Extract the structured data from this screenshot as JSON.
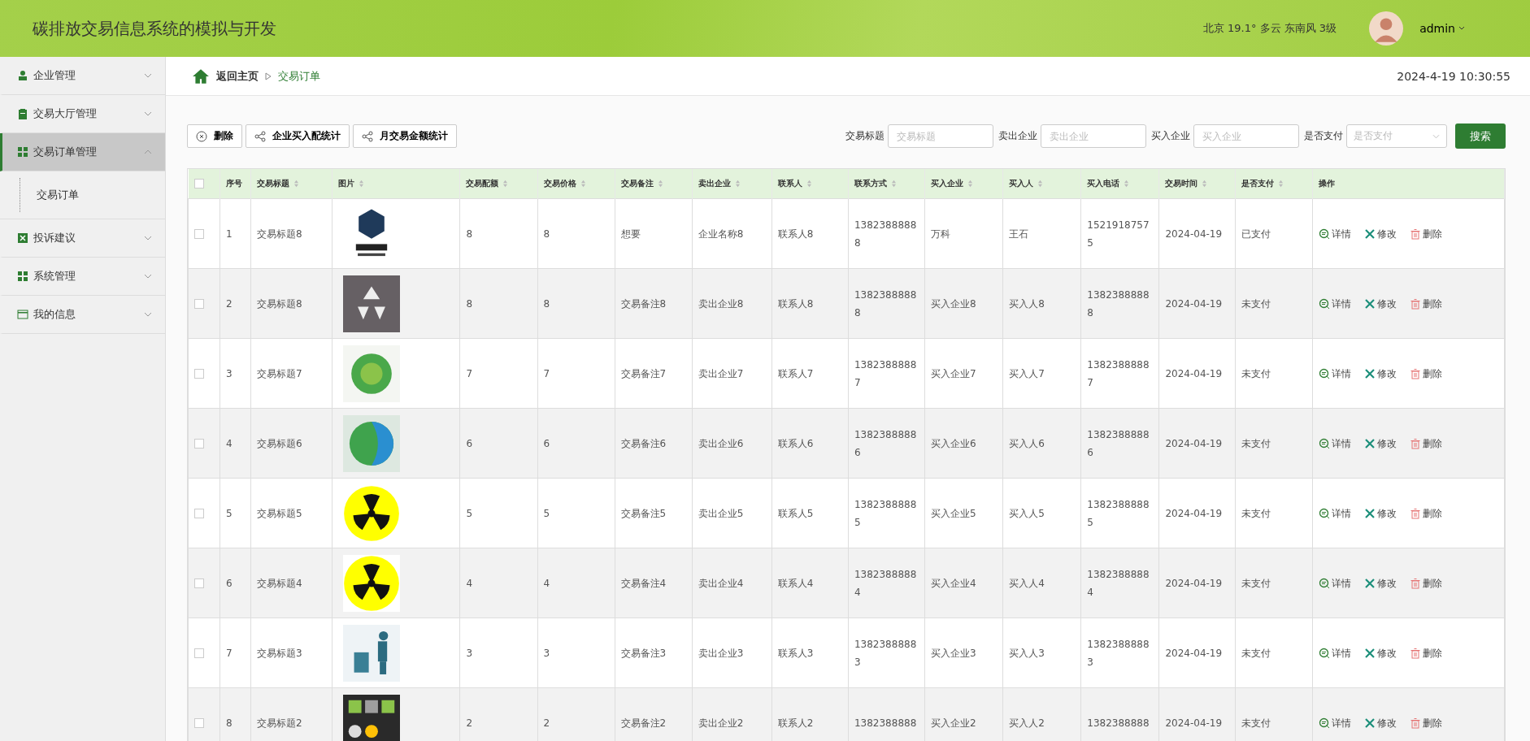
{
  "header": {
    "title": "碳排放交易信息系统的模拟与开发",
    "weather": "北京  19.1°  多云  东南风  3级",
    "user": "admin"
  },
  "sidebar": {
    "items": [
      {
        "label": "企业管理",
        "kind": "person",
        "expanded": false,
        "selected": false
      },
      {
        "label": "交易大厅管理",
        "kind": "clipboard",
        "expanded": false,
        "selected": false
      },
      {
        "label": "交易订单管理",
        "kind": "grid",
        "expanded": true,
        "selected": true,
        "children": [
          {
            "label": "交易订单"
          }
        ]
      },
      {
        "label": "投诉建议",
        "kind": "xbox",
        "expanded": false,
        "selected": false
      },
      {
        "label": "系统管理",
        "kind": "grid",
        "expanded": false,
        "selected": false
      },
      {
        "label": "我的信息",
        "kind": "card",
        "expanded": false,
        "selected": false
      }
    ]
  },
  "breadcrumb": {
    "home": "返回主页",
    "current": "交易订单",
    "datetime": "2024-4-19 10:30:55"
  },
  "toolbar": {
    "buttons": [
      {
        "label": "删除",
        "kind": "delete"
      },
      {
        "label": "企业买入配统计",
        "kind": "share"
      },
      {
        "label": "月交易金额统计",
        "kind": "share"
      }
    ]
  },
  "search": {
    "fields": [
      {
        "label": "交易标题",
        "placeholder": "交易标题",
        "kind": "text"
      },
      {
        "label": "卖出企业",
        "placeholder": "卖出企业",
        "kind": "text"
      },
      {
        "label": "买入企业",
        "placeholder": "买入企业",
        "kind": "text"
      },
      {
        "label": "是否支付",
        "placeholder": "是否支付",
        "kind": "select"
      }
    ],
    "button": "搜索"
  },
  "table": {
    "header_checked": false,
    "columns": [
      {
        "label": "序号",
        "sortable": false
      },
      {
        "label": "交易标题",
        "sortable": true
      },
      {
        "label": "图片",
        "sortable": true
      },
      {
        "label": "交易配额",
        "sortable": true
      },
      {
        "label": "交易价格",
        "sortable": true
      },
      {
        "label": "交易备注",
        "sortable": true
      },
      {
        "label": "卖出企业",
        "sortable": true
      },
      {
        "label": "联系人",
        "sortable": true
      },
      {
        "label": "联系方式",
        "sortable": true
      },
      {
        "label": "买入企业",
        "sortable": true
      },
      {
        "label": "买入人",
        "sortable": true
      },
      {
        "label": "买入电话",
        "sortable": true
      },
      {
        "label": "交易时间",
        "sortable": true
      },
      {
        "label": "是否支付",
        "sortable": true
      },
      {
        "label": "操作",
        "sortable": false
      }
    ],
    "rows": [
      {
        "checked": false,
        "actions": [
          "详情",
          "修改",
          "删除"
        ],
        "cells": [
          "1",
          "交易标题8",
          null,
          "8",
          "8",
          "想要",
          "企业名称8",
          "联系人8",
          "13823888888",
          "万科",
          "王石",
          "15219187575",
          "2024-04-19",
          "已支付"
        ]
      },
      {
        "checked": false,
        "actions": [
          "详情",
          "修改",
          "删除"
        ],
        "cells": [
          "2",
          "交易标题8",
          null,
          "8",
          "8",
          "交易备注8",
          "卖出企业8",
          "联系人8",
          "13823888888",
          "买入企业8",
          "买入人8",
          "13823888888",
          "2024-04-19",
          "未支付"
        ]
      },
      {
        "checked": false,
        "actions": [
          "详情",
          "修改",
          "删除"
        ],
        "cells": [
          "3",
          "交易标题7",
          null,
          "7",
          "7",
          "交易备注7",
          "卖出企业7",
          "联系人7",
          "13823888887",
          "买入企业7",
          "买入人7",
          "13823888887",
          "2024-04-19",
          "未支付"
        ]
      },
      {
        "checked": false,
        "actions": [
          "详情",
          "修改",
          "删除"
        ],
        "cells": [
          "4",
          "交易标题6",
          null,
          "6",
          "6",
          "交易备注6",
          "卖出企业6",
          "联系人6",
          "13823888886",
          "买入企业6",
          "买入人6",
          "13823888886",
          "2024-04-19",
          "未支付"
        ]
      },
      {
        "checked": false,
        "actions": [
          "详情",
          "修改",
          "删除"
        ],
        "cells": [
          "5",
          "交易标题5",
          null,
          "5",
          "5",
          "交易备注5",
          "卖出企业5",
          "联系人5",
          "13823888885",
          "买入企业5",
          "买入人5",
          "13823888885",
          "2024-04-19",
          "未支付"
        ]
      },
      {
        "checked": false,
        "actions": [
          "详情",
          "修改",
          "删除"
        ],
        "cells": [
          "6",
          "交易标题4",
          null,
          "4",
          "4",
          "交易备注4",
          "卖出企业4",
          "联系人4",
          "13823888884",
          "买入企业4",
          "买入人4",
          "13823888884",
          "2024-04-19",
          "未支付"
        ]
      },
      {
        "checked": false,
        "actions": [
          "详情",
          "修改",
          "删除"
        ],
        "cells": [
          "7",
          "交易标题3",
          null,
          "3",
          "3",
          "交易备注3",
          "卖出企业3",
          "联系人3",
          "13823888883",
          "买入企业3",
          "买入人3",
          "13823888883",
          "2024-04-19",
          "未支付"
        ]
      },
      {
        "checked": false,
        "actions": [
          "详情",
          "修改",
          "删除"
        ],
        "cells": [
          "8",
          "交易标题2",
          null,
          "2",
          "2",
          "交易备注2",
          "卖出企业2",
          "联系人2",
          "1382388888",
          "买入企业2",
          "买入人2",
          "1382388888",
          "2024-04-19",
          "未支付"
        ]
      }
    ]
  }
}
